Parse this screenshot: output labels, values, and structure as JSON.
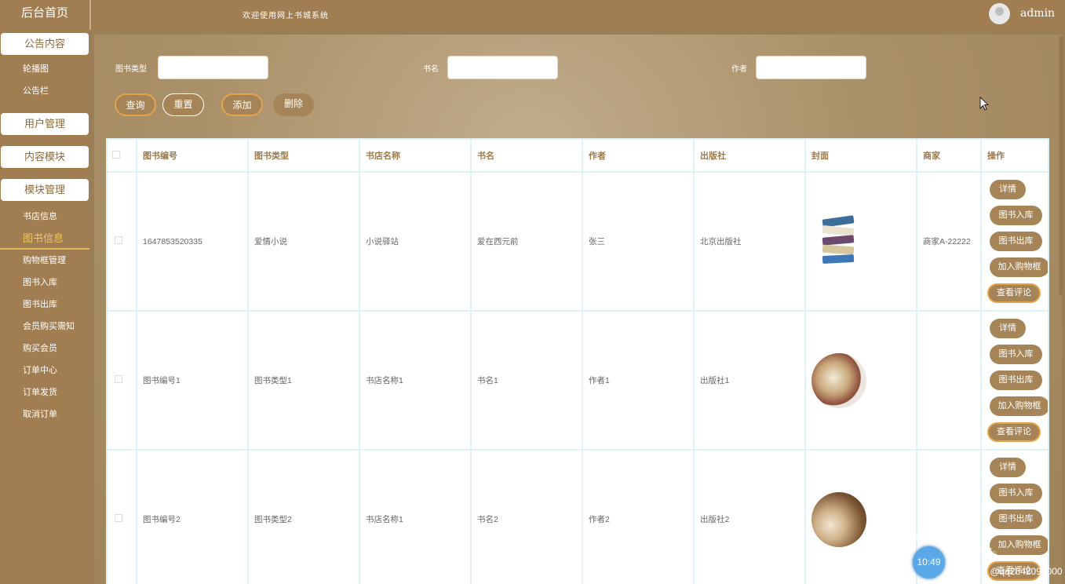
{
  "sidebar": {
    "home": "后台首页",
    "sections": [
      {
        "label": "公告内容",
        "items": [
          "轮播图",
          "公告栏"
        ]
      },
      {
        "label": "用户管理",
        "items": []
      },
      {
        "label": "内容模块",
        "items": []
      },
      {
        "label": "模块管理",
        "items": [
          "书店信息",
          "图书信息",
          "购物框管理",
          "图书入库",
          "图书出库",
          "会员购买需知",
          "购买会员",
          "订单中心",
          "订单发货",
          "取消订单"
        ]
      }
    ],
    "active_item": "图书信息"
  },
  "topbar": {
    "welcome": "欢迎使用网上书城系统",
    "user": "admin"
  },
  "search": {
    "type_label": "图书类型",
    "name_label": "书名",
    "author_label": "作者",
    "type_value": "",
    "name_value": "",
    "author_value": ""
  },
  "buttons": {
    "query": "查询",
    "reset": "重置",
    "add": "添加",
    "delete": "删除"
  },
  "table": {
    "headers": [
      "图书编号",
      "图书类型",
      "书店名称",
      "书名",
      "作者",
      "出版社",
      "封面",
      "商家",
      "操作"
    ],
    "rows": [
      {
        "id": "1647853520335",
        "type": "爱情小说",
        "store": "小说驿站",
        "name": "爱在西元前",
        "author": "张三",
        "publisher": "北京出版社",
        "merchant": "商家A-22222"
      },
      {
        "id": "图书编号1",
        "type": "图书类型1",
        "store": "书店名称1",
        "name": "书名1",
        "author": "作者1",
        "publisher": "出版社1",
        "merchant": ""
      },
      {
        "id": "图书编号2",
        "type": "图书类型2",
        "store": "书店名称1",
        "name": "书名2",
        "author": "作者2",
        "publisher": "出版社2",
        "merchant": ""
      }
    ],
    "ops": [
      "详情",
      "图书入库",
      "图书出库",
      "加入购物框",
      "查看评论"
    ]
  },
  "overlay": {
    "watermark_title": "激活 Windows",
    "watermark_sub": "转到\"设置\"以激活 Windows。",
    "clock": "10:49",
    "csdn": "CSDN @qq2542092000"
  },
  "colors": {
    "brand": "#a07e52",
    "accent_border": "#e6a24a",
    "active_text": "#f3c55b"
  }
}
